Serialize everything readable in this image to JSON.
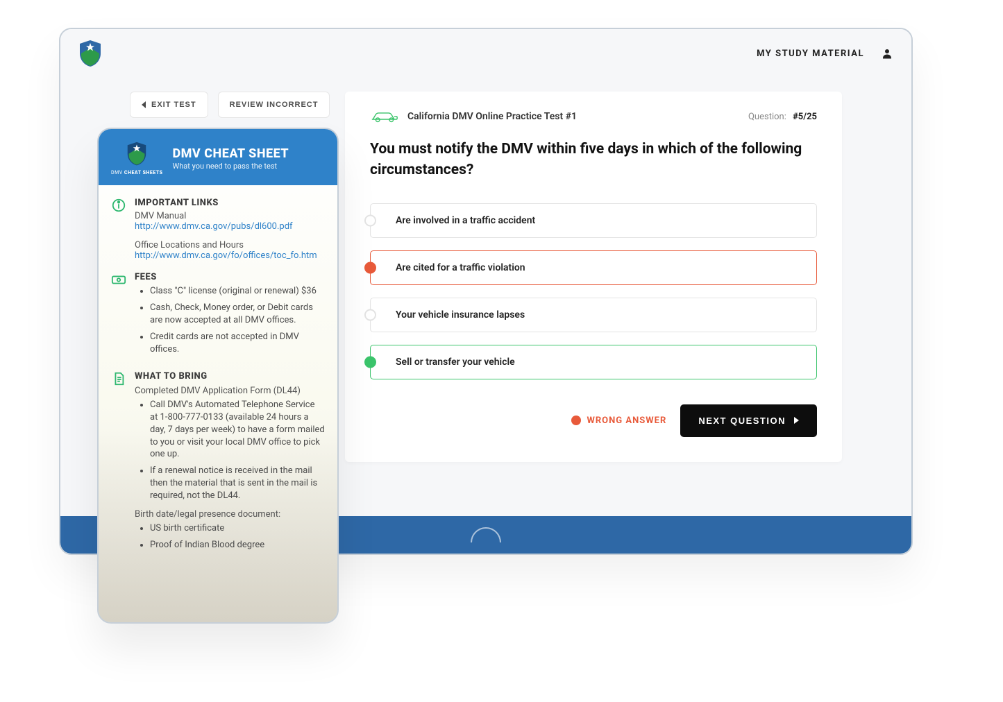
{
  "header": {
    "study_link": "MY STUDY MATERIAL"
  },
  "toolbar": {
    "exit_label": "EXIT TEST",
    "review_label": "REVIEW INCORRECT"
  },
  "quiz": {
    "title": "California DMV Online Practice Test #1",
    "counter_label": "Question:",
    "counter_value": "#5/25",
    "question": "You must notify the DMV within five days in which of the following circumstances?",
    "answers": [
      {
        "text": "Are involved in a traffic accident",
        "state": ""
      },
      {
        "text": "Are cited for a traffic violation",
        "state": "wrong"
      },
      {
        "text": "Your vehicle insurance lapses",
        "state": ""
      },
      {
        "text": "Sell or transfer your vehicle",
        "state": "correct"
      }
    ],
    "result_label": "WRONG ANSWER",
    "next_label": "NEXT QUESTION"
  },
  "cheat": {
    "logo_sub_a": "DMV",
    "logo_sub_b": "CHEAT SHEETS",
    "title": "DMV CHEAT SHEET",
    "subtitle": "What you need to pass the test",
    "links": {
      "title": "IMPORTANT LINKS",
      "manual_label": "DMV Manual",
      "manual_url": "http://www.dmv.ca.gov/pubs/dl600.pdf",
      "office_label": "Office Locations and Hours",
      "office_url": "http://www.dmv.ca.gov/fo/offices/toc_fo.htm"
    },
    "fees": {
      "title": "FEES",
      "items": [
        "Class \"C\" license (original or renewal) $36",
        "Cash, Check, Money order, or Debit cards are now accepted at all DMV offices.",
        "Credit cards are not accepted in DMV offices."
      ]
    },
    "bring": {
      "title": "WHAT TO BRING",
      "intro": "Completed DMV Application Form (DL44)",
      "items": [
        "Call DMV's Automated Telephone Service at 1-800-777-0133 (available 24 hours a day, 7 days per week) to have a form mailed to you or visit your local DMV office to pick one up.",
        "If a renewal notice is received in the mail then the material that is sent in the mail is required, not the DL44."
      ],
      "birth_label": "Birth date/legal presence document:",
      "birth_items": [
        "US birth certificate",
        "Proof of Indian Blood degree"
      ]
    }
  }
}
